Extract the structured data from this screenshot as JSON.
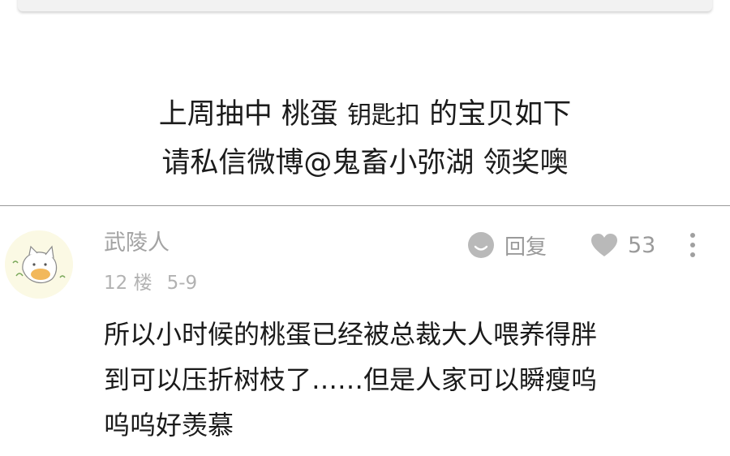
{
  "announcement": {
    "line1_a": "上周抽中 桃蛋",
    "line1_b": "钥匙扣",
    "line1_c": "的宝贝如下",
    "line2": "请私信微博@鬼畜小弥湖 领奖噢"
  },
  "comment": {
    "username": "武陵人",
    "floor": "12 楼",
    "date": "5-9",
    "reply_label": "回复",
    "like_count": "53",
    "text_lines": [
      "所以小时候的桃蛋已经被总裁大人喂养得胖",
      "到可以压折树枝了……但是人家可以瞬瘦呜",
      "呜呜好羡慕"
    ]
  },
  "colors": {
    "meta_gray": "#a3a3a3",
    "icon_gray": "#b5b5b5",
    "divider": "#9a9a9a",
    "avatar_bg": "#fbf9e4"
  },
  "icons": [
    "reply-bubble-icon",
    "heart-icon",
    "more-vertical-icon",
    "user-avatar"
  ]
}
